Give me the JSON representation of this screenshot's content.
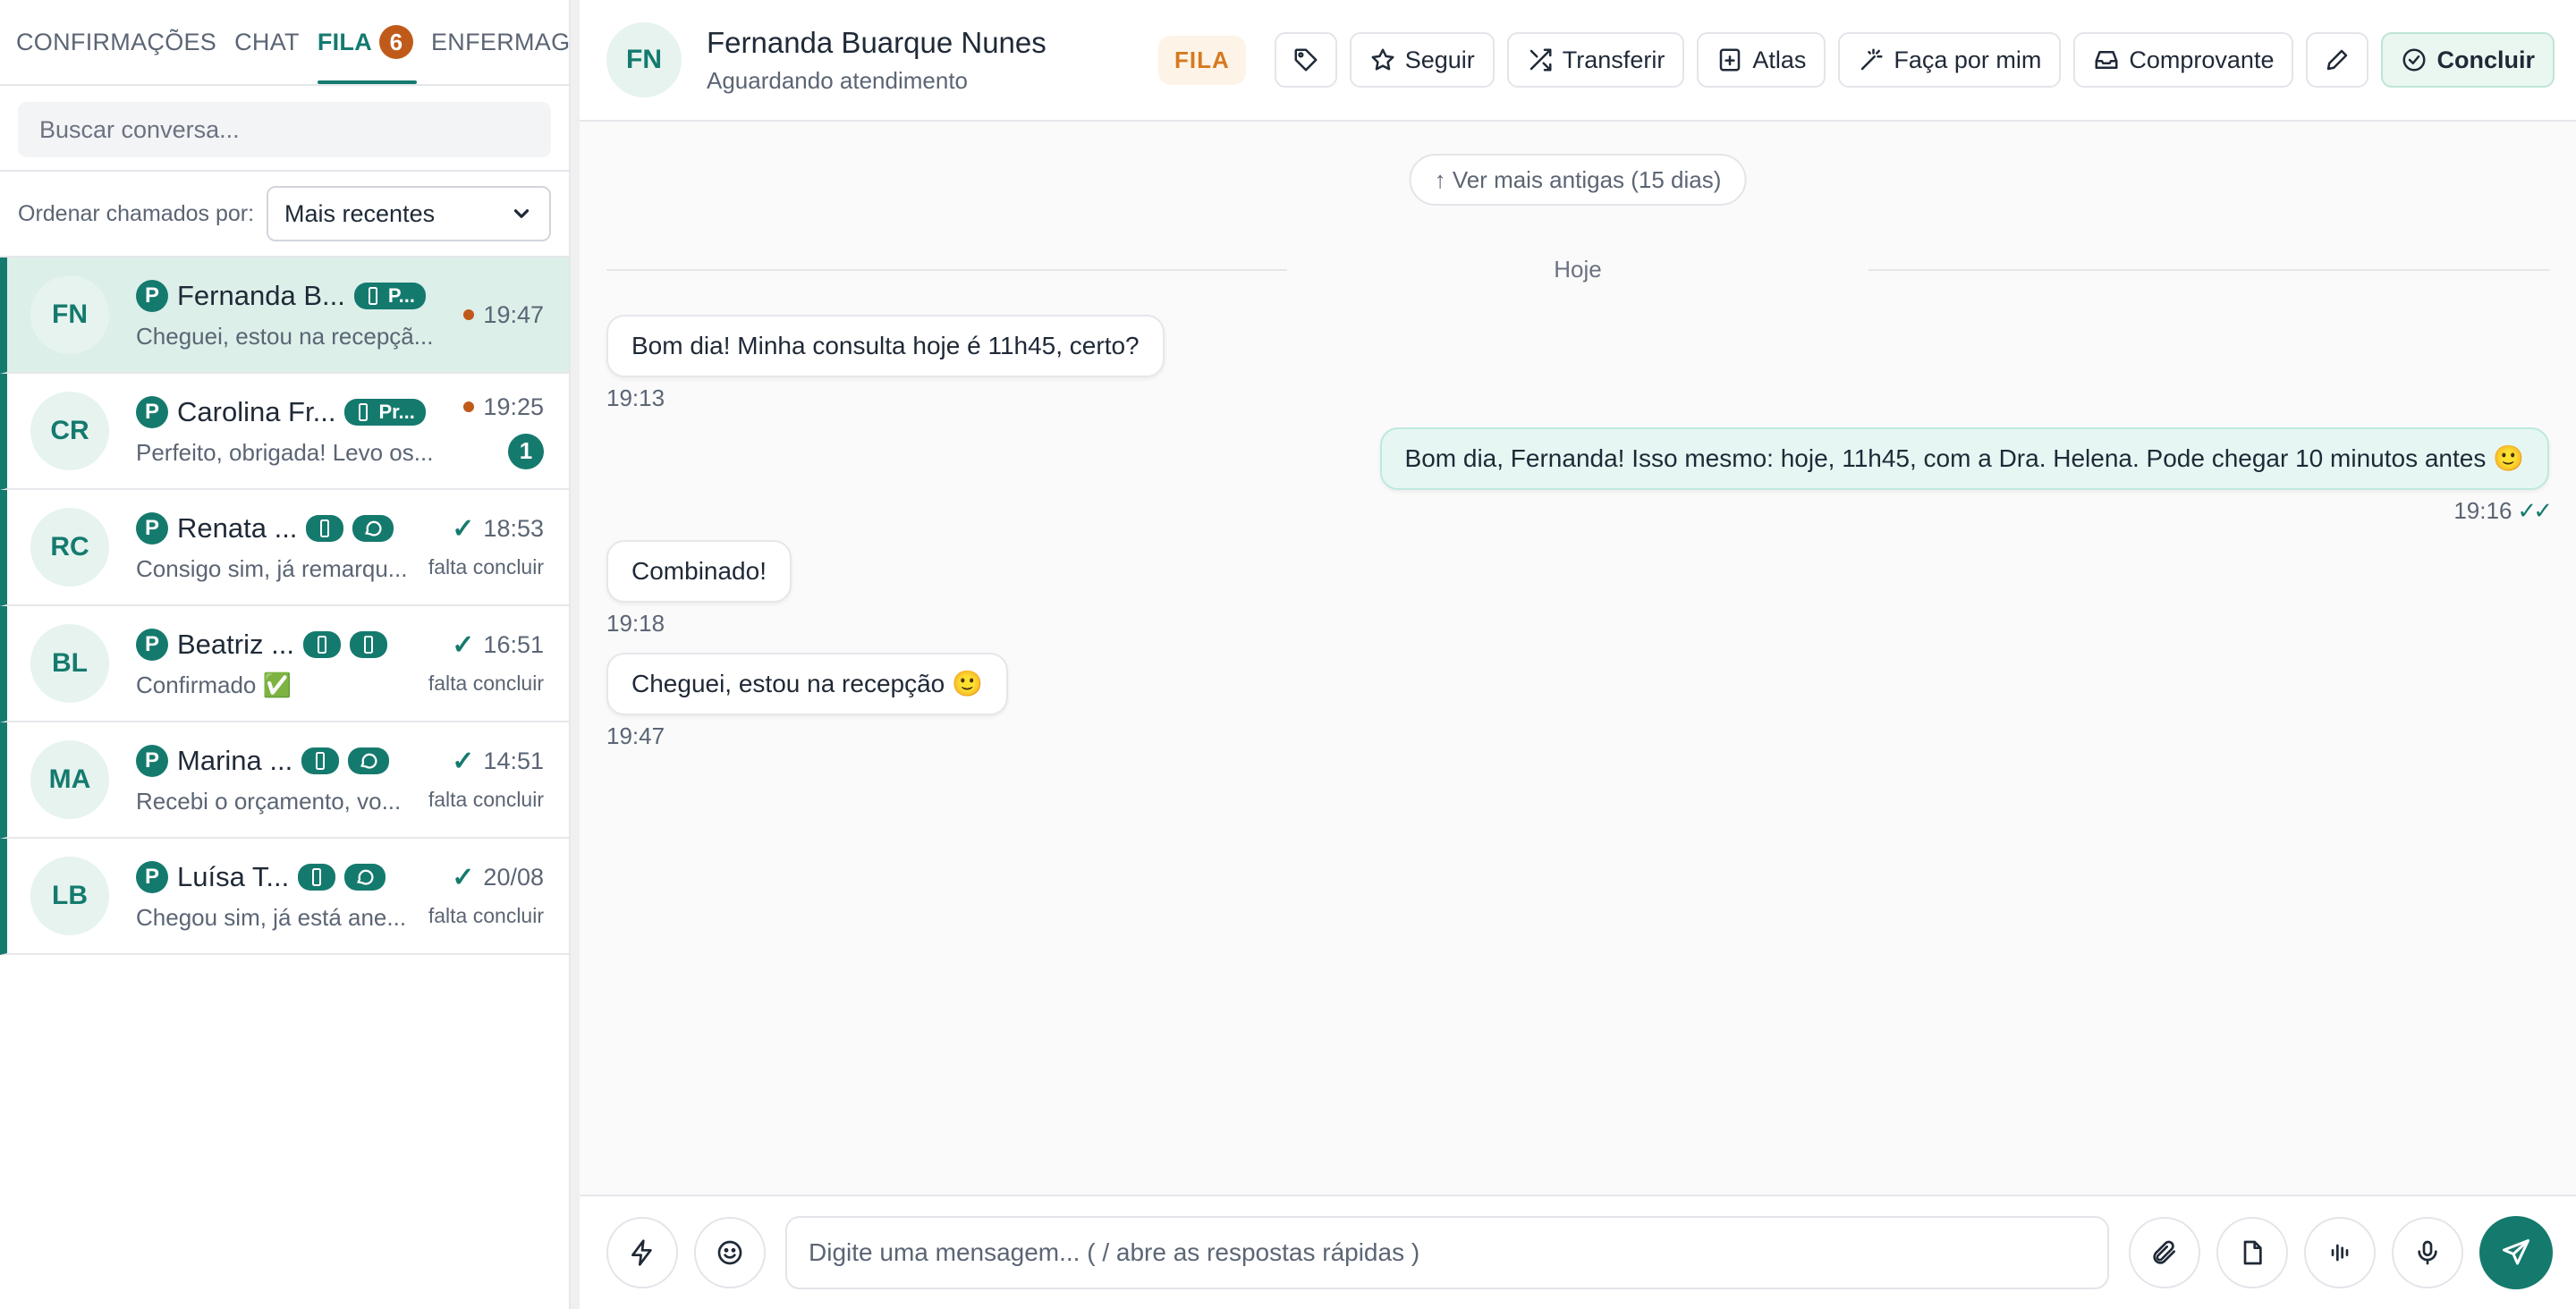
{
  "tabs": [
    {
      "label": "CONFIRMAÇÕES"
    },
    {
      "label": "CHAT"
    },
    {
      "label": "FILA",
      "badge": "6"
    },
    {
      "label": "ENFERMAGEM"
    }
  ],
  "search": {
    "placeholder": "Buscar conversa..."
  },
  "sort": {
    "label": "Ordenar chamados por:",
    "selected": "Mais recentes"
  },
  "conversations": [
    {
      "initials": "FN",
      "name": "Fernanda B...",
      "pill": "P...",
      "preview": "Cheguei, estou na recepçã...",
      "time": "19:47"
    },
    {
      "initials": "CR",
      "name": "Carolina Fr...",
      "pill": "Pr...",
      "preview": "Perfeito, obrigada! Levo os...",
      "time": "19:25",
      "unread": "1"
    },
    {
      "initials": "RC",
      "name": "Renata ...",
      "preview": "Consigo sim, já remarqu...",
      "time": "18:53",
      "status": "falta concluir"
    },
    {
      "initials": "BL",
      "name": "Beatriz ...",
      "preview": "Confirmado ✅",
      "time": "16:51",
      "status": "falta concluir"
    },
    {
      "initials": "MA",
      "name": "Marina ...",
      "preview": "Recebi o orçamento, vo...",
      "time": "14:51",
      "status": "falta concluir"
    },
    {
      "initials": "LB",
      "name": "Luísa T...",
      "preview": "Chegou sim, já está ane...",
      "time": "20/08",
      "status": "falta concluir"
    }
  ],
  "p_badge": "P",
  "header": {
    "initials": "FN",
    "name": "Fernanda Buarque Nunes",
    "status": "Aguardando atendimento",
    "badge": "FILA",
    "buttons": {
      "seguir": "Seguir",
      "transferir": "Transferir",
      "atlas": "Atlas",
      "faca": "Faça por mim",
      "comprovante": "Comprovante",
      "concluir": "Concluir"
    }
  },
  "chat": {
    "older": "↑ Ver mais antigas (15 dias)",
    "day": "Hoje",
    "messages": [
      {
        "text": "Bom dia! Minha consulta hoje é 11h45, certo?",
        "time": "19:13",
        "dir": "in"
      },
      {
        "text": "Bom dia, Fernanda! Isso mesmo: hoje, 11h45, com a Dra. Helena. Pode chegar 10 minutos antes 🙂",
        "time": "19:16",
        "dir": "out"
      },
      {
        "text": "Combinado!",
        "time": "19:18",
        "dir": "in"
      },
      {
        "text": "Cheguei, estou na recepção 🙂",
        "time": "19:47",
        "dir": "in"
      }
    ]
  },
  "composer": {
    "placeholder": "Digite uma mensagem... ( / abre as respostas rápidas )"
  },
  "colors": {
    "accent": "#157a6e",
    "warning": "#c05a1a",
    "fila": "#d6791f"
  }
}
